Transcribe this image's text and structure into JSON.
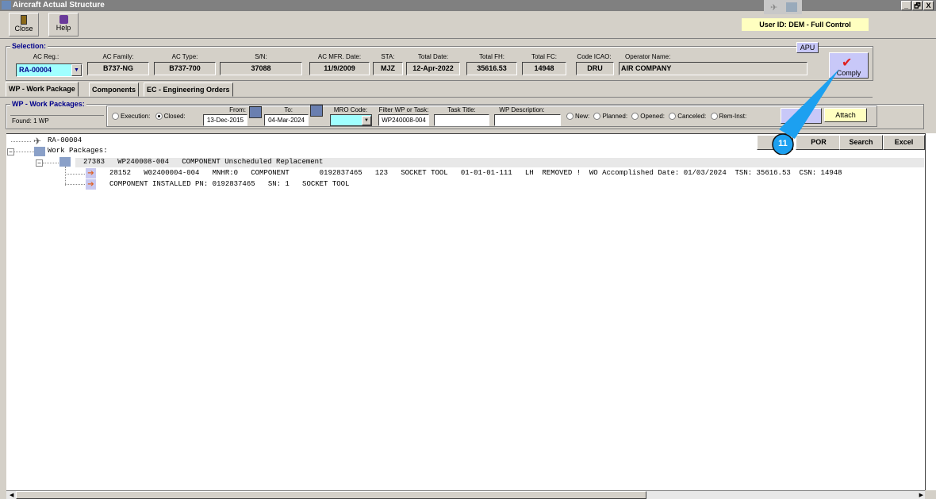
{
  "window": {
    "title": "Aircraft Actual Structure",
    "min": "_",
    "max": "🗗",
    "close": "X"
  },
  "toolbar": {
    "close": "Close",
    "help": "Help"
  },
  "user": "User ID: DEM - Full Control",
  "selection": {
    "title": "Selection:",
    "apu": "APU",
    "comply": "Comply",
    "fields": [
      {
        "label": "AC Reg.:",
        "value": "RA-00004"
      },
      {
        "label": "AC Family:",
        "value": "B737-NG"
      },
      {
        "label": "AC Type:",
        "value": "B737-700"
      },
      {
        "label": "S/N:",
        "value": "37088"
      },
      {
        "label": "AC MFR. Date:",
        "value": "11/9/2009"
      },
      {
        "label": "STA:",
        "value": "MJZ"
      },
      {
        "label": "Total Date:",
        "value": "12-Apr-2022"
      },
      {
        "label": "Total FH:",
        "value": "35616.53"
      },
      {
        "label": "Total FC:",
        "value": "14948"
      },
      {
        "label": "Code ICAO:",
        "value": "DRU"
      },
      {
        "label": "Operator Name:",
        "value": "AIR COMPANY"
      }
    ]
  },
  "tabs": [
    "WP - Work Package",
    "Components",
    "EC - Engineering Orders"
  ],
  "wp": {
    "title": "WP - Work Packages:",
    "found": "Found: 1 WP",
    "execution": "Execution:",
    "closed": "Closed:",
    "from_label": "From:",
    "from": "13-Dec-2015",
    "to_label": "To:",
    "to": "04-Mar-2024",
    "mro_label": "MRO Code:",
    "mro": "",
    "filter_label": "Filter WP or Task:",
    "filter": "WP240008-004",
    "task_label": "Task Title:",
    "task": "",
    "desc_label": "WP Description:",
    "desc": "",
    "statuses": [
      "New:",
      "Planned:",
      "Opened:",
      "Canceled:",
      "Rem-Inst:"
    ],
    "attach": "Attach"
  },
  "actions": {
    "por": "POR",
    "search": "Search",
    "excel": "Excel"
  },
  "callout": "11",
  "tree": {
    "root": "RA-00004",
    "wps": "Work Packages:",
    "wp_line": "27383   WP240008-004   COMPONENT Unscheduled Replacement",
    "task_line": "28152   W02400004-004   MNHR:0   COMPONENT       0192837465   123   SOCKET TOOL   01-01-01-111   LH  REMOVED !  WO Accomplished Date: 01/03/2024  TSN: 35616.53  CSN: 14948",
    "install_line": "COMPONENT INSTALLED PN: 0192837465   SN: 1   SOCKET TOOL"
  }
}
